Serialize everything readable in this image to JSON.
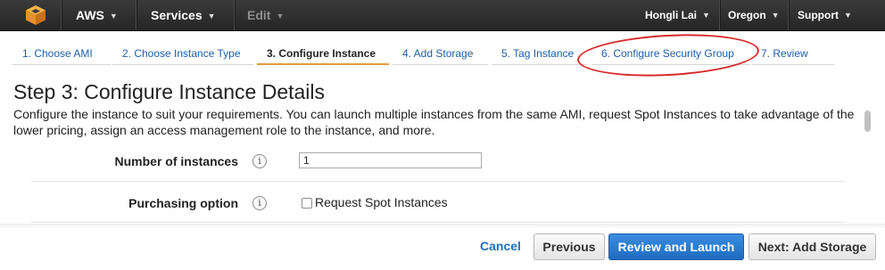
{
  "nav": {
    "brand": "AWS",
    "services": "Services",
    "edit": "Edit",
    "user": "Hongli Lai",
    "region": "Oregon",
    "support": "Support"
  },
  "wizard": {
    "tabs": [
      {
        "label": "1. Choose AMI"
      },
      {
        "label": "2. Choose Instance Type"
      },
      {
        "label": "3. Configure Instance"
      },
      {
        "label": "4. Add Storage"
      },
      {
        "label": "5. Tag Instance"
      },
      {
        "label": "6. Configure Security Group"
      },
      {
        "label": "7. Review"
      }
    ],
    "active_tab": "3. Configure Instance"
  },
  "page": {
    "title": "Step 3: Configure Instance Details",
    "description": "Configure the instance to suit your requirements. You can launch multiple instances from the same AMI, request Spot Instances to take advantage of the lower pricing, assign an access management role to the instance, and more."
  },
  "form": {
    "instances_label": "Number of instances",
    "instances_value": "1",
    "purchasing_label": "Purchasing option",
    "spot_label": "Request Spot Instances",
    "spot_checked": false,
    "info_glyph": "i"
  },
  "footer": {
    "cancel": "Cancel",
    "previous": "Previous",
    "review_launch": "Review and Launch",
    "next": "Next: Add Storage"
  },
  "colors": {
    "accent": "#e49b3c",
    "link": "#1b5fa8",
    "highlight": "#d82a2a",
    "primary_button": "#2b7bd0"
  }
}
